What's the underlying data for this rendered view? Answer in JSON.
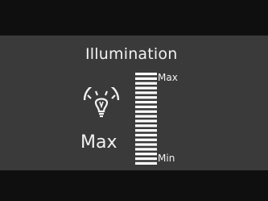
{
  "screen": {
    "title": "Illumination",
    "current_level_label": "Max",
    "scale": {
      "max_label": "Max",
      "min_label": "Min",
      "total_steps": 20,
      "level_fraction": 1.0
    }
  },
  "icons": {
    "illumination": "instrument-lamp-icon"
  },
  "colors": {
    "background": "#0f0f0f",
    "panel": "#3a3a3a",
    "text": "#f2f2f2",
    "segment_on": "#ffffff"
  }
}
